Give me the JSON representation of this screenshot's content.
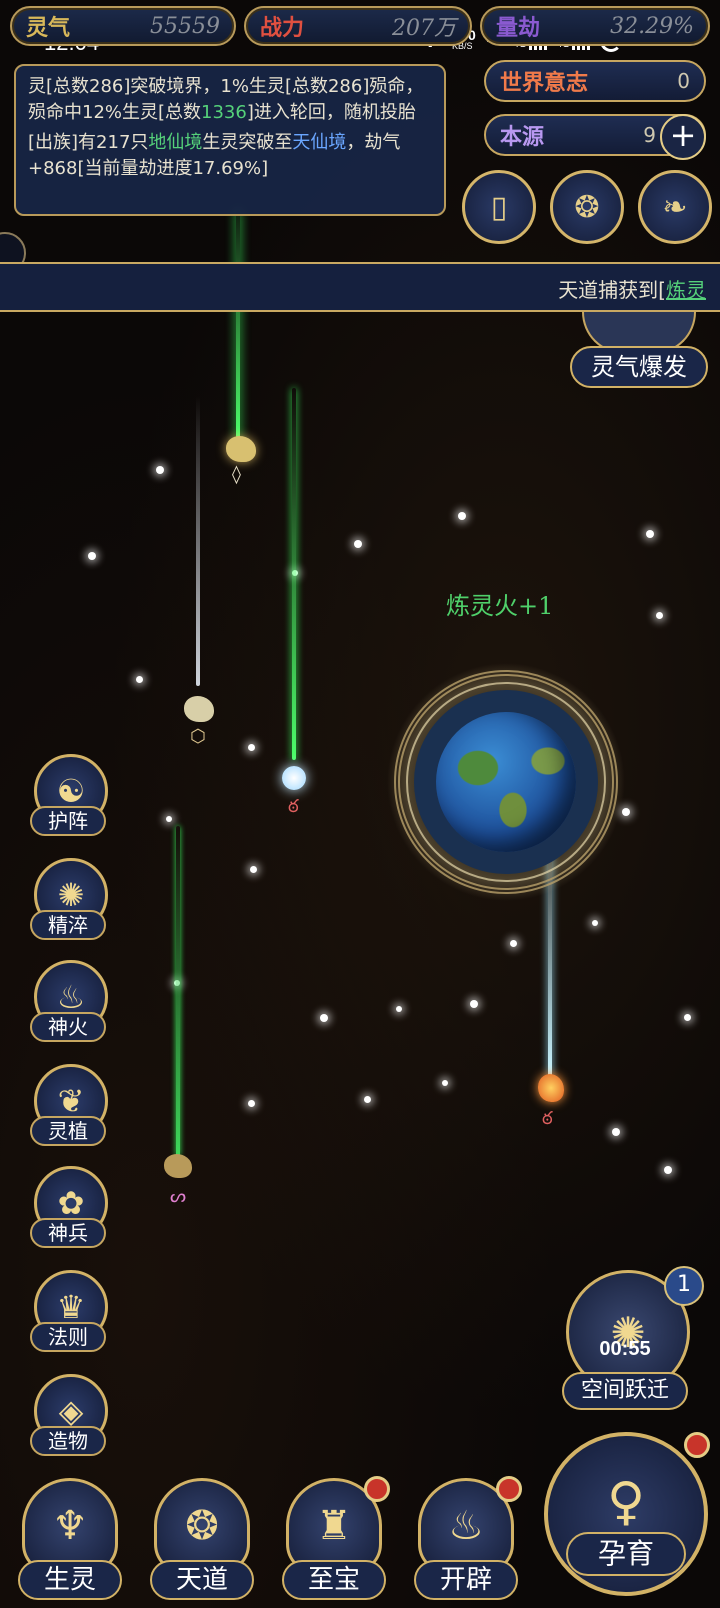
{
  "status_bar": {
    "time": "12:04",
    "net_speed": "8.00",
    "net_unit": "KB/S",
    "signal1": "4G",
    "signal2": "4G",
    "battery": "65%"
  },
  "resources": [
    {
      "label": "灵气",
      "value": "55559",
      "color": "#d8b85a"
    },
    {
      "label": "战力",
      "value": "207万",
      "color": "#e05040"
    },
    {
      "label": "量劫",
      "value": "32.29%",
      "color": "#8a5ad0"
    }
  ],
  "log": {
    "line1": "灵[总数286]突破境界，1%生灵[总数286]殒命，殒命中12%生灵[总数",
    "line1_hl": "1336",
    "line1_tail": "]进入轮回，随机投胎",
    "line2_a": "[出族]有217只",
    "line2_realm1": "地仙境",
    "line2_b": "生灵突破至",
    "line2_realm2": "天仙境",
    "line2_c": "，劫气+868[当前量劫进度17.69%]"
  },
  "right_panel": {
    "world_will_label": "世界意志",
    "world_will_value": "0",
    "world_will_color": "#f07a4a",
    "origin_label": "本源",
    "origin_value": "9",
    "origin_color": "#b898f0",
    "plus": "+"
  },
  "banner": {
    "text": "天道捕获到[",
    "highlight": "炼灵"
  },
  "float_text": "炼灵火+1",
  "burst_button": "灵气爆发",
  "side_buttons": [
    {
      "label": "护阵",
      "icon": "yin-yang-icon",
      "glyph": "☯"
    },
    {
      "label": "精淬",
      "icon": "lotus-flame-icon",
      "glyph": "✺"
    },
    {
      "label": "神火",
      "icon": "fire-icon",
      "glyph": "♨"
    },
    {
      "label": "灵植",
      "icon": "plant-icon",
      "glyph": "❦"
    },
    {
      "label": "神兵",
      "icon": "flower-icon",
      "glyph": "✿"
    },
    {
      "label": "法则",
      "icon": "beast-icon",
      "glyph": "♛"
    },
    {
      "label": "造物",
      "icon": "diamond-icon",
      "glyph": "◈"
    }
  ],
  "warp": {
    "label": "空间跃迁",
    "timer": "00:55",
    "count": "1"
  },
  "bottom_nav": [
    {
      "label": "生灵",
      "icon": "phoenix-icon",
      "glyph": "♆",
      "badge": false
    },
    {
      "label": "天道",
      "icon": "cloud-swirl-icon",
      "glyph": "❂",
      "badge": false
    },
    {
      "label": "至宝",
      "icon": "treasure-icon",
      "glyph": "♜",
      "badge": true
    },
    {
      "label": "开辟",
      "icon": "flame-axe-icon",
      "glyph": "♨",
      "badge": true
    }
  ],
  "main_button": {
    "label": "孕育",
    "icon": "figure-icon",
    "glyph": "♀"
  }
}
